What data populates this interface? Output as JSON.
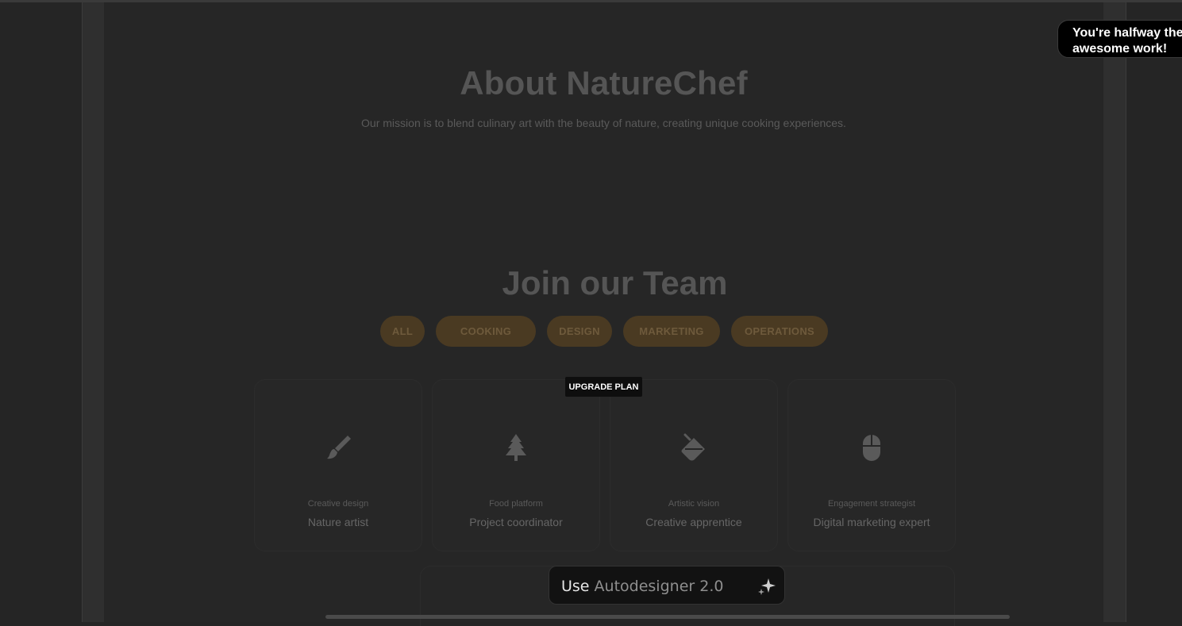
{
  "about": {
    "title": "About NatureChef",
    "subtitle": "Our mission is to blend culinary art with the beauty of nature, creating unique cooking experiences."
  },
  "team": {
    "title": "Join our Team",
    "filters": [
      "ALL",
      "COOKING",
      "DESIGN",
      "MARKETING",
      "OPERATIONS"
    ],
    "cards": [
      {
        "icon": "paintbrush-icon",
        "category": "Creative design",
        "role": "Nature artist"
      },
      {
        "icon": "tree-icon",
        "category": "Food platform",
        "role": "Project coordinator"
      },
      {
        "icon": "paint-bucket-icon",
        "category": "Artistic vision",
        "role": "Creative apprentice"
      },
      {
        "icon": "mouse-icon",
        "category": "Engagement strategist",
        "role": "Digital marketing expert"
      }
    ]
  },
  "upgrade_badge": "UPGRADE PLAN",
  "toast": {
    "line1": "You're halfway the",
    "line2": "awesome work!"
  },
  "autodesigner": {
    "prefix": "Use",
    "brand": "Autodesigner 2.0"
  },
  "colors": {
    "background": "#252525",
    "pill_bg": "#4a3a22",
    "pill_text": "#6e5a3c",
    "muted_text": "#555555"
  }
}
